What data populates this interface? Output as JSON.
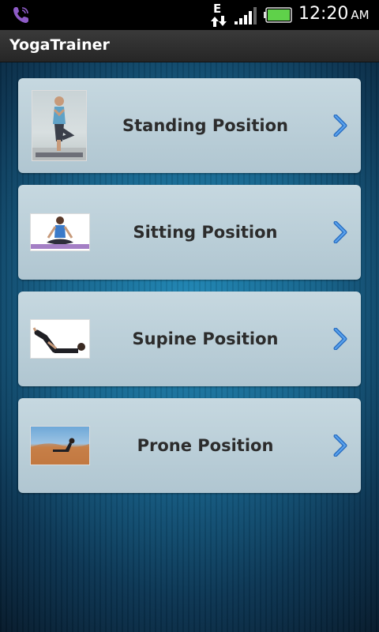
{
  "status_bar": {
    "data_indicator": "E",
    "time": "12:20",
    "ampm": "AM"
  },
  "action_bar": {
    "title": "YogaTrainer"
  },
  "positions": [
    {
      "label": "Standing Position"
    },
    {
      "label": "Sitting Position"
    },
    {
      "label": "Supine Position"
    },
    {
      "label": "Prone Position"
    }
  ],
  "colors": {
    "accent_chevron": "#2f7fd6",
    "card_bg": "#bfd2db",
    "action_bar": "#2f2f2f",
    "label_text": "#2c2c2c"
  }
}
